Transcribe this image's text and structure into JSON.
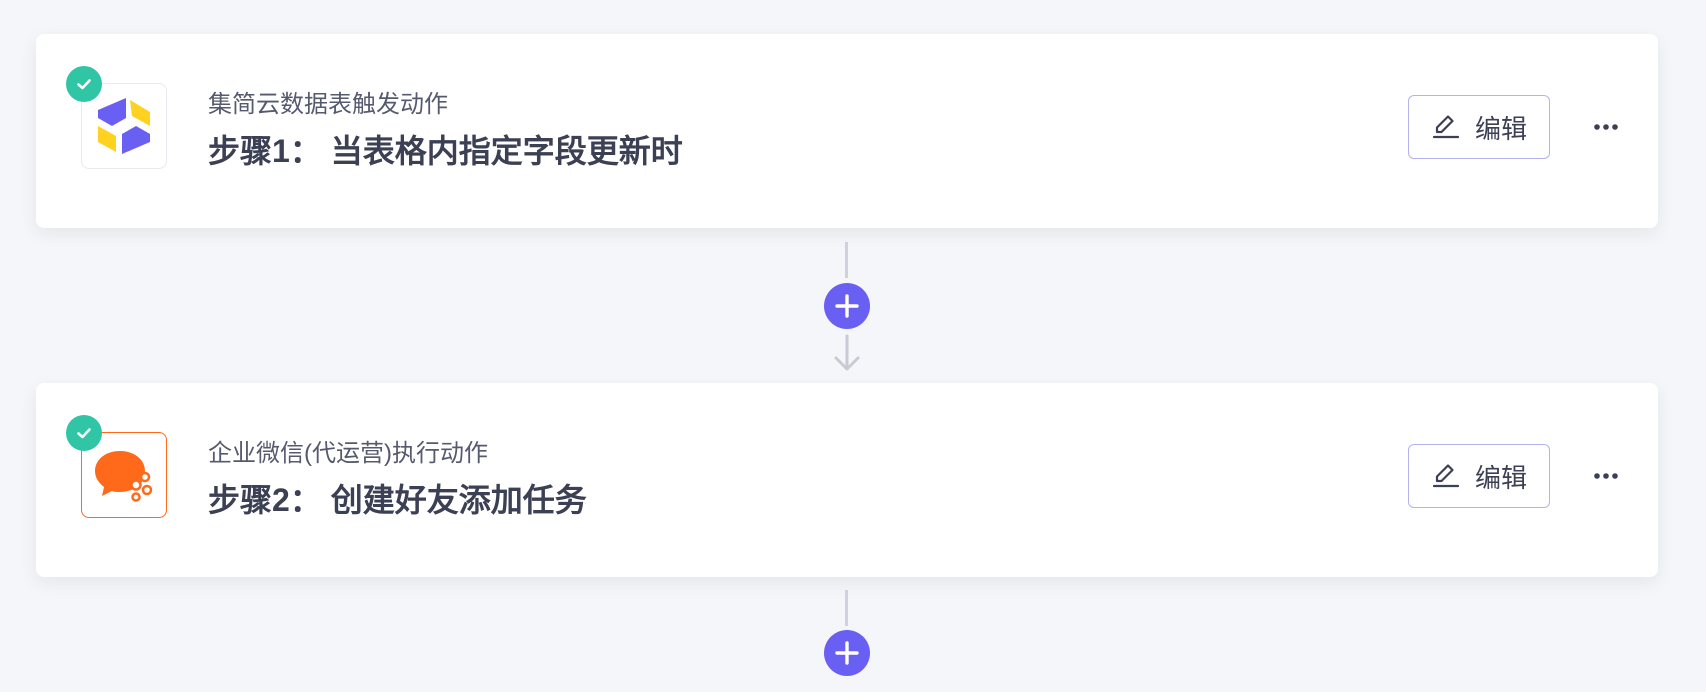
{
  "steps": [
    {
      "app_name": "集简云数据表触发动作",
      "title": "步骤1： 当表格内指定字段更新时",
      "edit_label": "编辑",
      "icon": "jijianyun-logo-icon",
      "status": "completed"
    },
    {
      "app_name": "企业微信(代运营)执行动作",
      "title": "步骤2： 创建好友添加任务",
      "edit_label": "编辑",
      "icon": "wecom-logo-icon",
      "status": "completed"
    }
  ],
  "colors": {
    "accent": "#6a5ff3",
    "success": "#2fc5a5",
    "wecom_orange": "#ff6a1a",
    "background": "#f5f6f9"
  },
  "icons": {
    "edit": "pencil-icon",
    "more": "more-dots-icon",
    "add": "plus-icon",
    "check": "check-icon",
    "arrow": "arrow-down-icon"
  }
}
